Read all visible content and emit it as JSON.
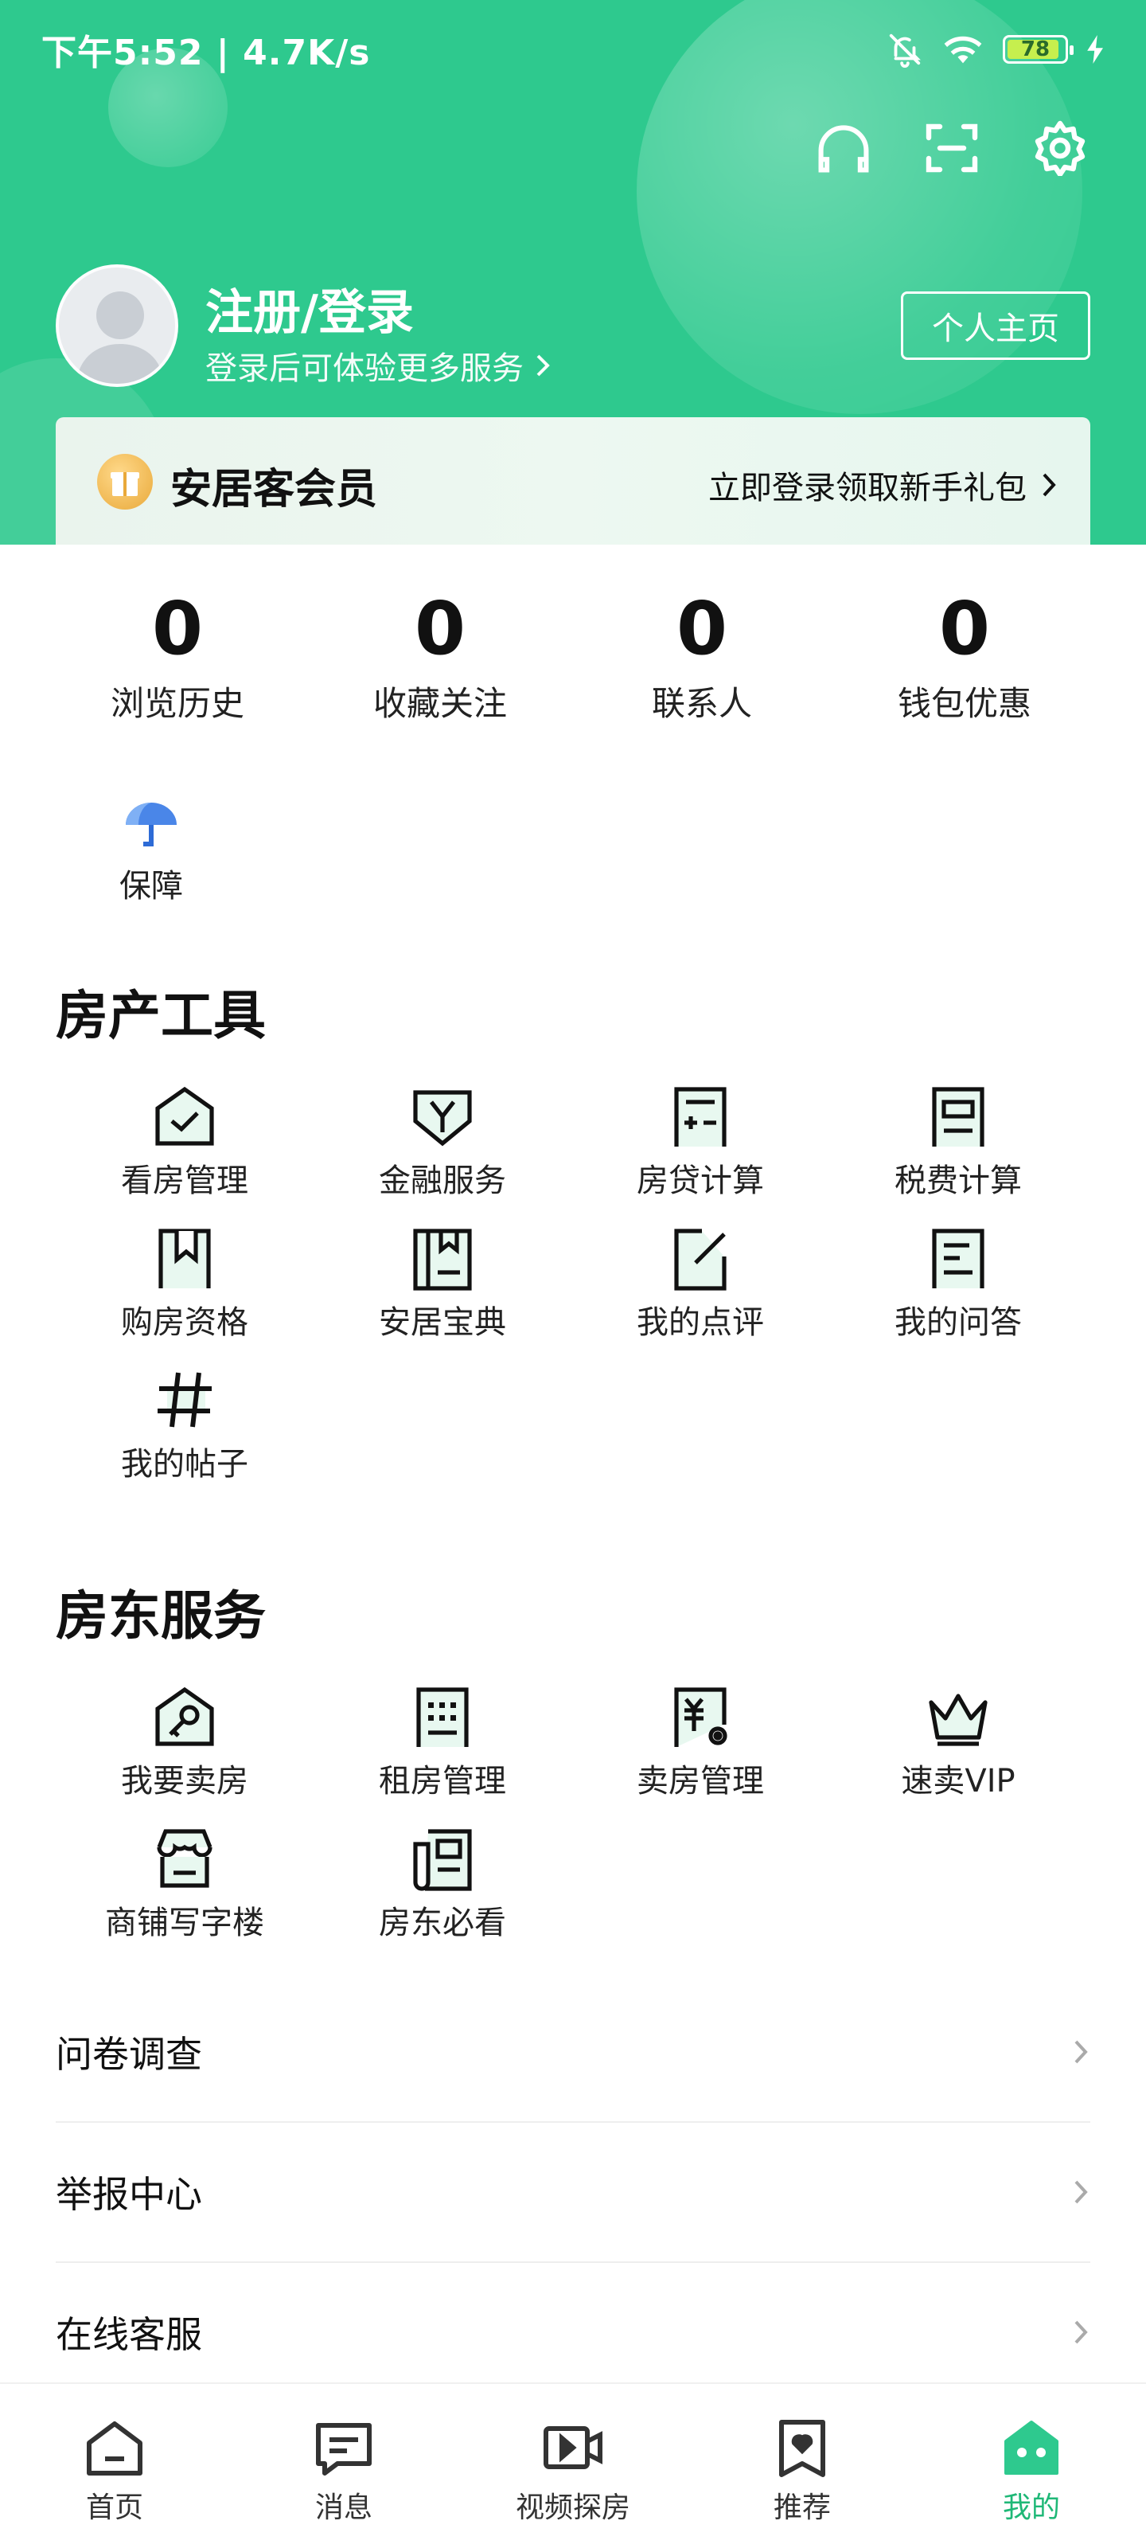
{
  "status_bar": {
    "time": "下午5:52",
    "net_speed": "4.7K/s",
    "battery": "78"
  },
  "header": {
    "login_title": "注册/登录",
    "login_subtitle": "登录后可体验更多服务",
    "profile_button": "个人主页"
  },
  "vip": {
    "title": "安居客会员",
    "promo": "立即登录领取新手礼包"
  },
  "stats": [
    {
      "value": "0",
      "label": "浏览历史"
    },
    {
      "value": "0",
      "label": "收藏关注"
    },
    {
      "value": "0",
      "label": "联系人"
    },
    {
      "value": "0",
      "label": "钱包优惠"
    }
  ],
  "guarantee": {
    "label": "保障"
  },
  "property_tools": {
    "title": "房产工具",
    "items": [
      {
        "label": "看房管理",
        "icon": "house-check-icon"
      },
      {
        "label": "金融服务",
        "icon": "shield-y-icon"
      },
      {
        "label": "房贷计算",
        "icon": "calculator-icon"
      },
      {
        "label": "税费计算",
        "icon": "tax-doc-icon"
      },
      {
        "label": "购房资格",
        "icon": "bookmark-icon"
      },
      {
        "label": "安居宝典",
        "icon": "book-icon"
      },
      {
        "label": "我的点评",
        "icon": "edit-icon"
      },
      {
        "label": "我的问答",
        "icon": "qa-doc-icon"
      },
      {
        "label": "我的帖子",
        "icon": "hash-icon"
      }
    ]
  },
  "landlord_services": {
    "title": "房东服务",
    "items": [
      {
        "label": "我要卖房",
        "icon": "house-key-icon"
      },
      {
        "label": "租房管理",
        "icon": "building-icon"
      },
      {
        "label": "卖房管理",
        "icon": "yen-doc-icon"
      },
      {
        "label": "速卖VIP",
        "icon": "crown-icon"
      },
      {
        "label": "商铺写字楼",
        "icon": "shop-icon"
      },
      {
        "label": "房东必看",
        "icon": "newspaper-icon"
      }
    ]
  },
  "list": [
    {
      "label": "问卷调查"
    },
    {
      "label": "举报中心"
    },
    {
      "label": "在线客服"
    }
  ],
  "tabbar": [
    {
      "label": "首页",
      "icon": "home-icon"
    },
    {
      "label": "消息",
      "icon": "message-icon"
    },
    {
      "label": "视频探房",
      "icon": "video-icon"
    },
    {
      "label": "推荐",
      "icon": "heart-bookmark-icon"
    },
    {
      "label": "我的",
      "icon": "me-icon",
      "active": true
    }
  ],
  "colors": {
    "brand_green": "#2ec98e",
    "active_tab": "#1fb877"
  }
}
